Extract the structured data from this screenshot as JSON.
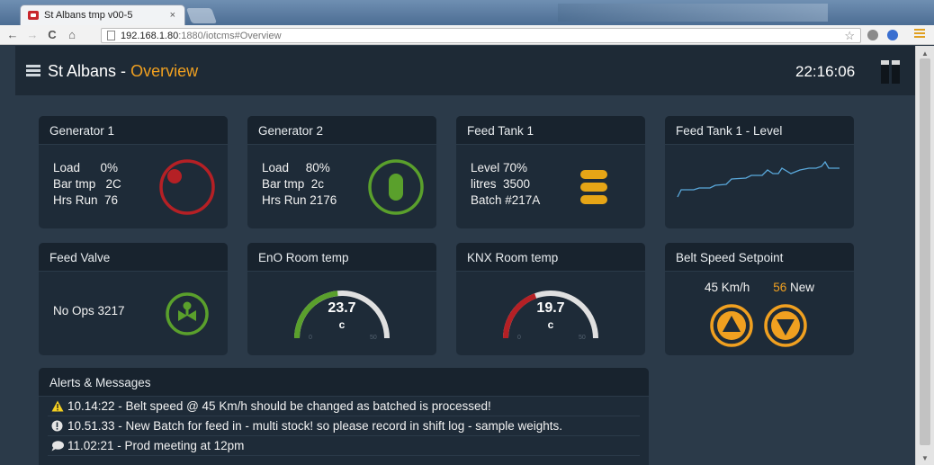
{
  "browser": {
    "tab_title": "St Albans tmp v00-5",
    "tab_close": "×",
    "url_host": "192.168.1.80",
    "url_path": ":1880/iotcms#Overview",
    "nav": {
      "back": "←",
      "forward": "→",
      "reload": "C",
      "home": "⌂"
    }
  },
  "header": {
    "title_prefix": "St Albans - ",
    "title_page": "Overview",
    "time": "22:16:06"
  },
  "widgets": {
    "generator1": {
      "title": "Generator 1",
      "lines": [
        "Load      0%",
        "Bar tmp   2C",
        "Hrs Run  76"
      ],
      "icon_color": "#b52025"
    },
    "generator2": {
      "title": "Generator 2",
      "lines": [
        "Load     80%",
        "Bar tmp  2c",
        "Hrs Run 2176"
      ],
      "icon_color": "#5aa02c"
    },
    "feed_tank1": {
      "title": "Feed Tank 1",
      "lines": [
        "Level 70%",
        "litres  3500",
        "Batch #217A"
      ],
      "icon_color": "#e6a516"
    },
    "feed_tank1_level": {
      "title": "Feed Tank 1 - Level",
      "line_color": "#5aa9dc"
    },
    "feed_valve": {
      "title": "Feed Valve",
      "text": "No Ops 3217",
      "icon_color": "#5aa02c"
    },
    "eno_room_temp": {
      "title": "EnO Room temp",
      "value": "23.7",
      "unit": "c",
      "min": "0",
      "max": "50",
      "level": 0.47,
      "color": "#5aa02c"
    },
    "knx_room_temp": {
      "title": "KNX Room temp",
      "value": "19.7",
      "unit": "c",
      "min": "0",
      "max": "50",
      "level": 0.39,
      "color": "#b52025"
    },
    "belt_speed": {
      "title": "Belt Speed Setpoint",
      "current": "45 Km/h",
      "new_value": "56",
      "new_label": " New",
      "color": "#f0a020"
    }
  },
  "alerts": {
    "title": "Alerts & Messages",
    "items": [
      {
        "icon": "warning-icon",
        "text": "10.14:22 - Belt speed @ 45 Km/h should be changed as batched is processed!"
      },
      {
        "icon": "info-icon",
        "text": "10.51.33 - New Batch for feed in - multi stock! so please record in shift log - sample weights."
      },
      {
        "icon": "comment-icon",
        "text": "11.02:21 - Prod meeting at 12pm"
      }
    ]
  }
}
